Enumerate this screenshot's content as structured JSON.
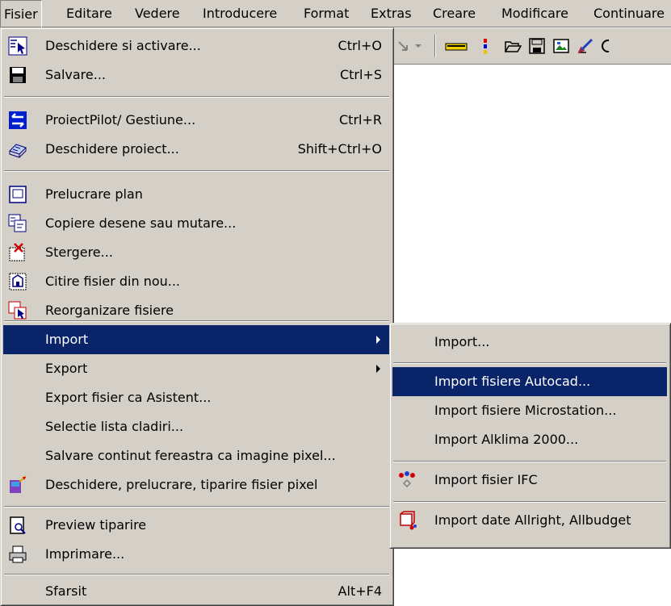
{
  "menubar": {
    "items": [
      {
        "label": "Fisier"
      },
      {
        "label": "Editare"
      },
      {
        "label": "Vedere"
      },
      {
        "label": "Introducere"
      },
      {
        "label": "Format"
      },
      {
        "label": "Extras"
      },
      {
        "label": "Creare"
      },
      {
        "label": "Modificare"
      },
      {
        "label": "Continuare"
      }
    ]
  },
  "file_menu": {
    "items": [
      {
        "label": "Deschidere si activare...",
        "shortcut": "Ctrl+O",
        "icon": "open-activate-icon"
      },
      {
        "label": "Salvare...",
        "shortcut": "Ctrl+S",
        "icon": "floppy-disk-icon"
      },
      {
        "label": "ProiectPilot/ Gestiune...",
        "shortcut": "Ctrl+R",
        "icon": "project-pilot-icon"
      },
      {
        "label": "Deschidere proiect...",
        "shortcut": "Shift+Ctrl+O",
        "icon": "open-project-icon"
      },
      {
        "label": "Prelucrare plan",
        "icon": "plan-icon"
      },
      {
        "label": "Copiere desene sau mutare...",
        "icon": "copy-drawings-icon"
      },
      {
        "label": "Stergere...",
        "icon": "delete-files-icon"
      },
      {
        "label": "Citire fisier din nou...",
        "icon": "reload-file-icon"
      },
      {
        "label": "Reorganizare fisiere",
        "icon": "reorganize-files-icon"
      },
      {
        "label": "Import",
        "submenu": true
      },
      {
        "label": "Export",
        "submenu": true
      },
      {
        "label": "Export fisier ca Asistent..."
      },
      {
        "label": "Selectie lista cladiri..."
      },
      {
        "label": "Salvare continut fereastra ca imagine pixel..."
      },
      {
        "label": "Deschidere, prelucrare, tiparire fisier pixel",
        "icon": "pixel-image-icon"
      },
      {
        "label": "Preview tiparire",
        "icon": "print-preview-icon"
      },
      {
        "label": "Imprimare...",
        "icon": "printer-icon"
      },
      {
        "label": "Sfarsit",
        "shortcut": "Alt+F4"
      }
    ]
  },
  "import_submenu": {
    "items": [
      {
        "label": "Import..."
      },
      {
        "label": "Import fisiere Autocad..."
      },
      {
        "label": "Import fisiere Microstation..."
      },
      {
        "label": "Import Alklima 2000..."
      },
      {
        "label": "Import fisier IFC",
        "icon": "ifc-icon"
      },
      {
        "label": "Import date Allright, Allbudget",
        "icon": "allright-icon"
      }
    ]
  },
  "colors": {
    "menu_bg": "#d4d0c8",
    "highlight_bg": "#0a246a",
    "highlight_text": "#ffffff"
  }
}
